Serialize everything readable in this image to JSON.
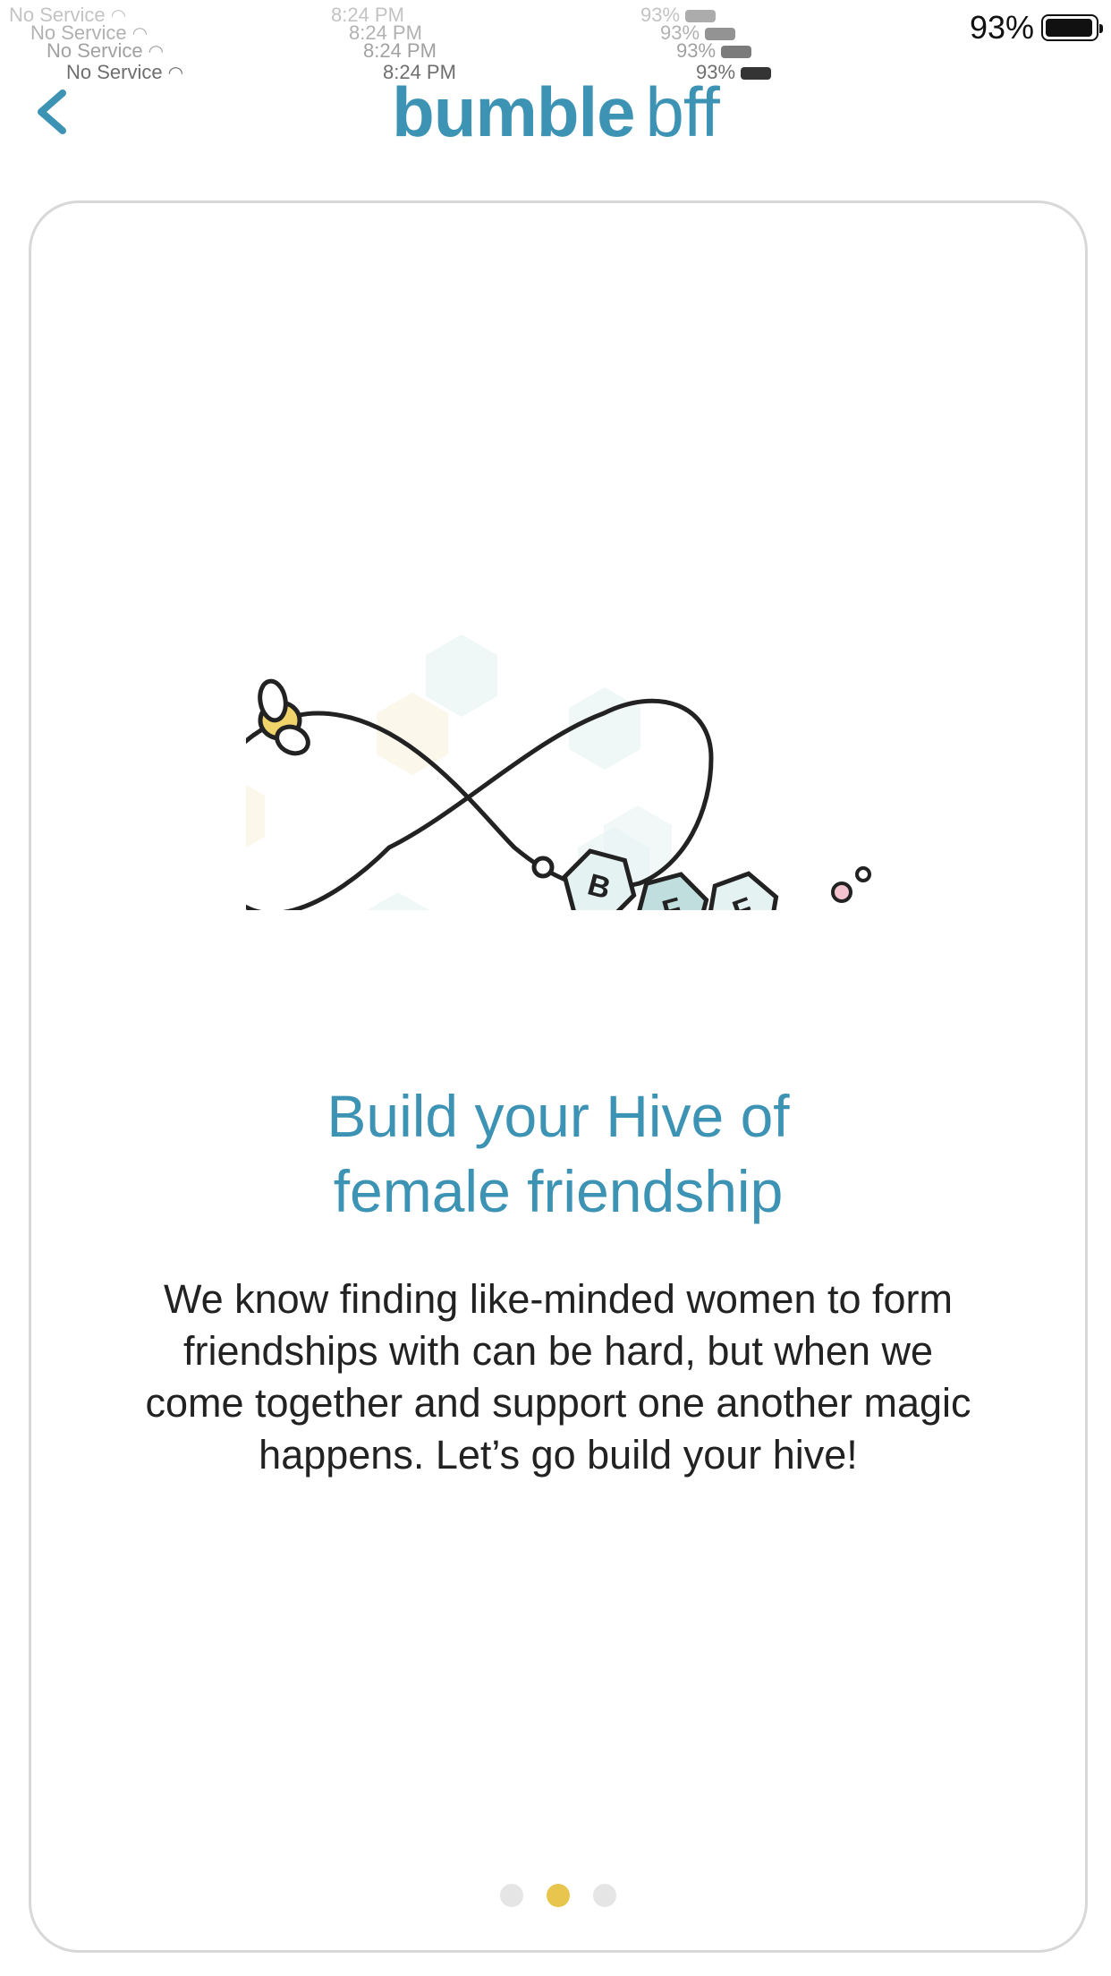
{
  "status_bar": {
    "carrier": "No Service",
    "time": "8:24 PM",
    "battery": "93%"
  },
  "header": {
    "logo_word1": "bumble",
    "logo_word2": "bff",
    "back_icon": "chevron-left-icon"
  },
  "card": {
    "illustration_letters": [
      "B",
      "F",
      "F"
    ],
    "headline_lines": [
      "Build your Hive of",
      "female friendship"
    ],
    "body_lines": [
      "We know finding like-minded women to form",
      "friendships with can be hard, but when we",
      "come together and support one another magic",
      "happens. Let’s go build your hive!"
    ]
  },
  "pager": {
    "count": 3,
    "active_index": 1
  },
  "colors": {
    "brand": "#3d93b4",
    "active_dot": "#e8c64e",
    "inactive_dot": "#e5e5e5",
    "card_border": "#d8d8d8"
  }
}
